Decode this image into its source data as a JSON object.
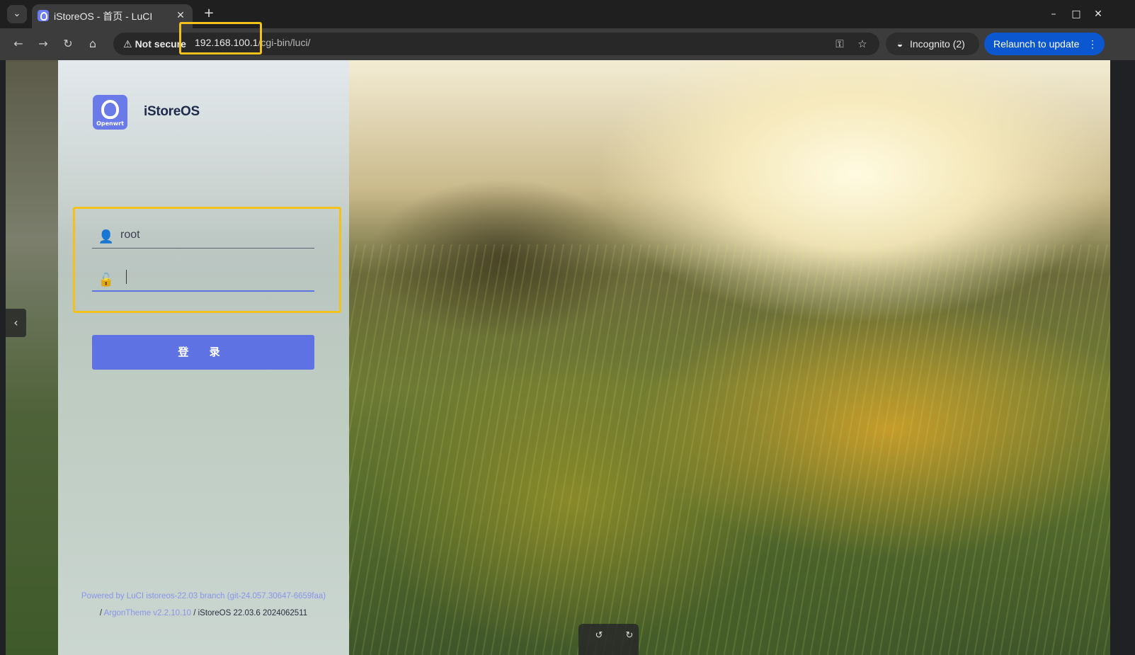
{
  "browser": {
    "tab_title": "iStoreOS - 首页 - LuCI",
    "new_tab_label": "+",
    "close_tab_glyph": "✕",
    "not_secure_label": "Not secure",
    "url_host": "192.168.100.1",
    "url_path": "/cgi-bin/luci/",
    "incognito_label": "Incognito (2)",
    "relaunch_label": "Relaunch to update",
    "window_controls": [
      "–",
      "□",
      "✕"
    ]
  },
  "login": {
    "brand_name": "iStoreOS",
    "logo_sub_label": "Openwrt",
    "username_value": "root",
    "password_value": "",
    "submit_label": "登 录"
  },
  "footer": {
    "powered_by": "Powered by LuCI istoreos-22.03 branch (git-24.057.30647-6659faa)",
    "separator": "/",
    "theme_link": "ArgonTheme v2.2.10.10",
    "version": "/ iStoreOS 22.03.6 2024062511"
  },
  "colors": {
    "accent": "#5e72e4",
    "highlight": "#f2c21b",
    "relaunch": "#0b57d0"
  }
}
